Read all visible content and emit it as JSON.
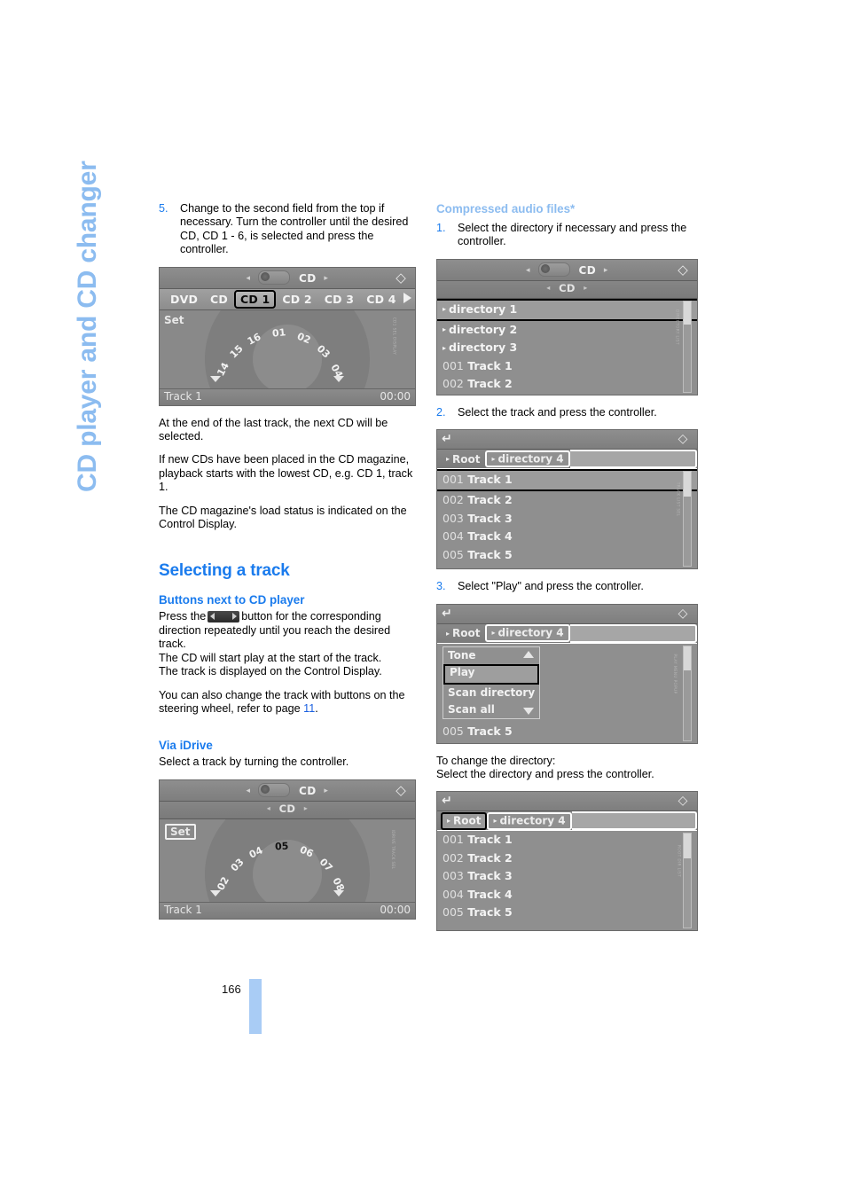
{
  "chapter_tab": "CD player and CD changer",
  "page_number": "166",
  "colors": {
    "heading_blue": "#1a7bed",
    "light_blue": "#8cbcf0",
    "link_blue": "#1a5fe0",
    "footer_bar": "#a9ccf5"
  },
  "left_column": {
    "step5": {
      "num": "5.",
      "text": "Change to the second field from the top if necessary. Turn the controller until the desired CD, CD 1 - 6, is selected and press the controller."
    },
    "para1": "At the end of the last track, the next CD will be selected.",
    "para2": "If new CDs have been placed in the CD magazine, playback starts with the lowest CD, e.g. CD 1, track 1.",
    "para3": "The CD magazine's load status is indicated on the Control Display.",
    "section_title": "Selecting a track",
    "sub1_title": "Buttons next to CD player",
    "sub1_para_a": "Press the",
    "sub1_para_b": "button for the corresponding direction repeatedly until you reach the desired track.",
    "sub1_para_c": "The CD will start play at the start of the track.",
    "sub1_para_d": "The track is displayed on the Control Display.",
    "sub1_para_e1": "You can also change the track with buttons on the steering wheel, refer to page",
    "sub1_para_e_link": "11",
    "sub1_para_e2": ".",
    "sub2_title": "Via iDrive",
    "sub2_para": "Select a track by turning the controller."
  },
  "right_column": {
    "heading": "Compressed audio files*",
    "step1": {
      "num": "1.",
      "text": "Select the directory if necessary and press the controller."
    },
    "step2": {
      "num": "2.",
      "text": "Select the track and press the controller."
    },
    "step3": {
      "num": "3.",
      "text": "Select \"Play\" and press the controller."
    },
    "closing1": "To change the directory:",
    "closing2": "Select the directory and press the controller."
  },
  "screens": {
    "cd_selector": {
      "header_title": "CD",
      "header_arrow_left": "◂",
      "header_arrow_right": "▸",
      "home_icon": "home-icon",
      "tabs": [
        "DVD",
        "CD",
        "CD 1",
        "CD 2",
        "CD 3",
        "CD 4"
      ],
      "selected_tab": "CD 1",
      "more_icon": "more-right-icon",
      "set_label": "Set",
      "dial_numbers": [
        "14",
        "15",
        "16",
        "01",
        "02",
        "03",
        "04"
      ],
      "dial_active": null,
      "status_left": "Track 1",
      "status_right": "00:00",
      "credit": "CD1 SEL DISPLAY"
    },
    "idrive_track": {
      "header_title": "CD",
      "row2_title": "CD",
      "set_label": "Set",
      "dial_numbers": [
        "02",
        "03",
        "04",
        "05",
        "06",
        "07",
        "08"
      ],
      "dial_active": "05",
      "status_left": "Track 1",
      "status_right": "00:00",
      "credit": "IDRIVE TRACK SEL"
    },
    "directory_list": {
      "header_title": "CD",
      "row2_title": "CD",
      "rows": [
        {
          "label": "directory 1",
          "arrow": true,
          "selected": true
        },
        {
          "label": "directory 2",
          "arrow": true,
          "selected": false
        },
        {
          "label": "directory 3",
          "arrow": true,
          "selected": false
        },
        {
          "num": "001",
          "label": "Track 1",
          "arrow": false,
          "selected": false
        },
        {
          "num": "002",
          "label": "Track 2",
          "arrow": false,
          "selected": false
        }
      ],
      "credit": "DIRECTORY LIST"
    },
    "track_list": {
      "back_icon": "back-arrow-icon",
      "info_icon": "info-icon",
      "crumbs": [
        "Root",
        "directory 4"
      ],
      "active_crumb": "directory 4",
      "rows": [
        {
          "num": "001",
          "label": "Track 1",
          "selected": true
        },
        {
          "num": "002",
          "label": "Track 2",
          "selected": false
        },
        {
          "num": "003",
          "label": "Track 3",
          "selected": false
        },
        {
          "num": "004",
          "label": "Track 4",
          "selected": false
        },
        {
          "num": "005",
          "label": "Track 5",
          "selected": false
        }
      ],
      "credit": "TRACK LIST SEL"
    },
    "play_menu": {
      "back_icon": "back-arrow-icon",
      "info_icon": "info-icon",
      "crumbs": [
        "Root",
        "directory 4"
      ],
      "active_crumb": "directory 4",
      "menu_items": [
        "Tone",
        "Play",
        "Scan directory",
        "Scan all"
      ],
      "menu_selected": "Play",
      "background_row": {
        "num": "005",
        "label": "Track 5"
      },
      "credit": "PLAY MENU POPUP"
    },
    "root_list": {
      "back_icon": "back-arrow-icon",
      "info_icon": "info-icon",
      "crumbs": [
        "Root",
        "directory 4"
      ],
      "active_crumb": "Root",
      "rows": [
        {
          "num": "001",
          "label": "Track 1",
          "selected": false
        },
        {
          "num": "002",
          "label": "Track 2",
          "selected": false
        },
        {
          "num": "003",
          "label": "Track 3",
          "selected": false
        },
        {
          "num": "004",
          "label": "Track 4",
          "selected": false
        },
        {
          "num": "005",
          "label": "Track 5",
          "selected": false
        }
      ],
      "credit": "ROOT DIR LIST"
    }
  }
}
